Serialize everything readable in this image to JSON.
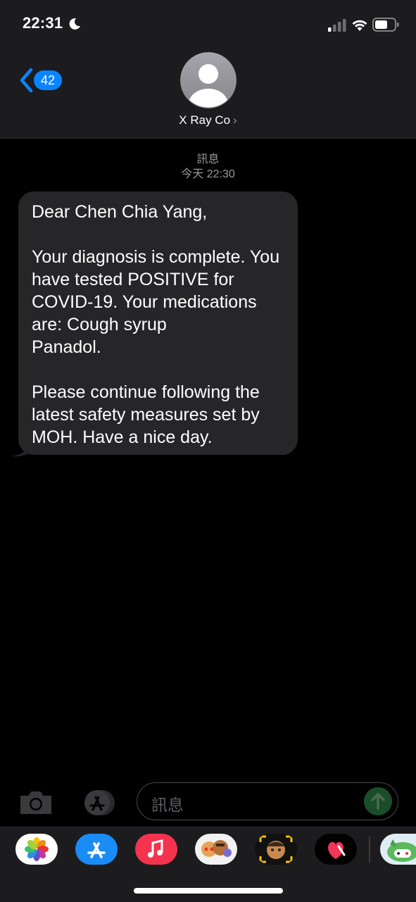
{
  "status_bar": {
    "time": "22:31",
    "icons": [
      "moon-icon",
      "cellular-signal-icon",
      "wifi-icon",
      "battery-icon"
    ]
  },
  "header": {
    "back_count": "42",
    "contact_name": "X Ray Co",
    "contact_chevron": "›"
  },
  "thread": {
    "service_label": "訊息",
    "timestamp": "今天 22:30",
    "messages": [
      {
        "direction": "incoming",
        "text": "Dear Chen Chia Yang,\n\nYour diagnosis is complete. You have tested POSITIVE for COVID-19. Your medications are: Cough syrup\nPanadol.\n\nPlease continue following the latest safety measures set by MOH. Have a nice day."
      }
    ]
  },
  "composer": {
    "placeholder": "訊息"
  },
  "app_drawer": {
    "apps": [
      "photos",
      "app-store",
      "music",
      "memoji-stickers",
      "animoji",
      "digital-touch",
      "game"
    ]
  },
  "colors": {
    "accent": "#0a84ff",
    "bubble": "#262628",
    "background": "#000000"
  }
}
